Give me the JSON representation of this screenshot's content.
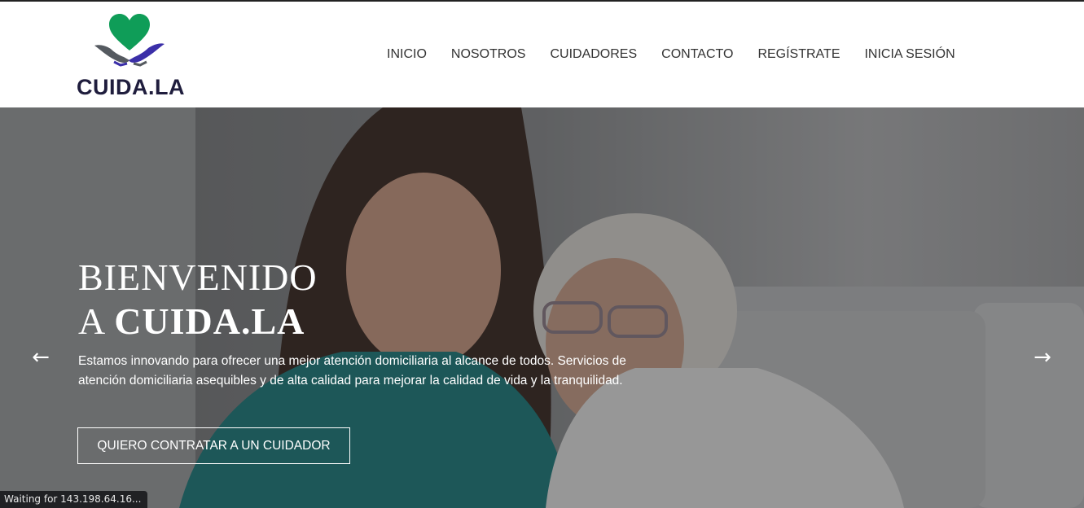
{
  "brand": {
    "name": "CUIDA.LA",
    "heart_color": "#0f9d58",
    "hands_colors": [
      "#555a60",
      "#3b2fa8"
    ]
  },
  "nav": {
    "items": [
      {
        "label": "INICIO"
      },
      {
        "label": "NOSOTROS"
      },
      {
        "label": "CUIDADORES"
      },
      {
        "label": "CONTACTO"
      },
      {
        "label": "REGÍSTRATE"
      },
      {
        "label": "INICIA SESIÓN"
      }
    ]
  },
  "hero": {
    "title_line1": "BIENVENIDO",
    "title_line2_prefix": "A ",
    "title_line2_brand": "CUIDA.LA",
    "subtitle": "Estamos innovando para ofrecer una mejor atención domiciliaria al alcance de todos. Servicios de atención domiciliaria asequibles y de alta calidad para mejorar la calidad de vida y la tranquilidad.",
    "cta_label": "QUIERO CONTRATAR A UN CUIDADOR",
    "prev_icon": "arrow-left-icon",
    "next_icon": "arrow-right-icon"
  },
  "status_bar": {
    "text": "Waiting for 143.198.64.16..."
  }
}
